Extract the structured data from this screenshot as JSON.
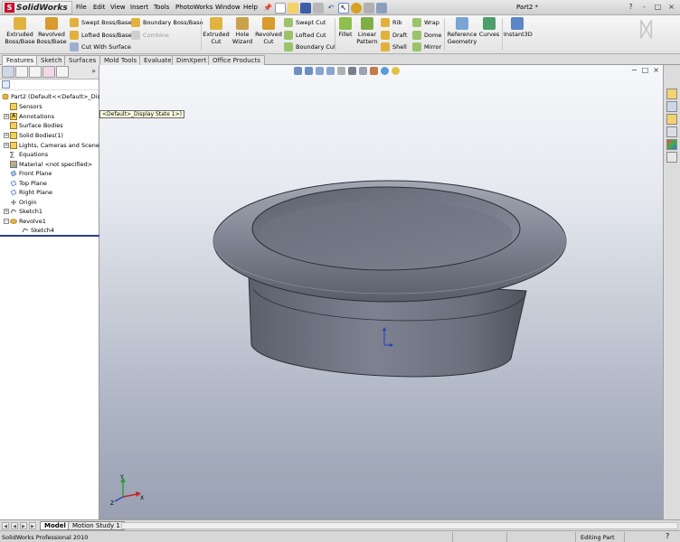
{
  "app": {
    "logo_mark": "S",
    "logo_text": "SolidWorks",
    "document_title": "Part2 *"
  },
  "menu": [
    "File",
    "Edit",
    "View",
    "Insert",
    "Tools",
    "PhotoWorks",
    "Window",
    "Help"
  ],
  "window_controls": [
    "?",
    "-",
    "□",
    "×"
  ],
  "ribbon": {
    "extruded_boss": "Extruded Boss/Base",
    "revolved_boss": "Revolved Boss/Base",
    "swept_boss": "Swept Boss/Base",
    "lofted_boss": "Lofted Boss/Base",
    "boundary_boss": "Boundary Boss/Base",
    "combine": "Combine",
    "cut_with_surface": "Cut With Surface",
    "extruded_cut": "Extruded Cut",
    "hole_wizard": "Hole Wizard",
    "revolved_cut": "Revolved Cut",
    "swept_cut": "Swept Cut",
    "lofted_cut": "Lofted Cut",
    "boundary_cut": "Boundary Cut",
    "fillet": "Fillet",
    "linear_pattern": "Linear Pattern",
    "rib": "Rib",
    "draft": "Draft",
    "shell": "Shell",
    "wrap": "Wrap",
    "dome": "Dome",
    "mirror": "Mirror",
    "reference_geometry": "Reference Geometry",
    "curves": "Curves",
    "instant3d": "Instant3D"
  },
  "tabs": [
    "Features",
    "Sketch",
    "Surfaces",
    "Mold Tools",
    "Evaluate",
    "DimXpert",
    "Office Products"
  ],
  "feature_tree": {
    "part": "Part2  (Default<<Default>_Displa",
    "tooltip": "<Default>_Display State 1>)",
    "items": [
      {
        "label": "Sensors",
        "icon": "sensor-icon"
      },
      {
        "label": "Annotations",
        "icon": "annotation-icon"
      },
      {
        "label": "Surface Bodies",
        "icon": "surface-bodies-icon"
      },
      {
        "label": "Solid Bodies(1)",
        "icon": "solid-bodies-icon"
      },
      {
        "label": "Lights, Cameras and Scene",
        "icon": "lights-icon"
      },
      {
        "label": "Equations",
        "icon": "equations-icon"
      },
      {
        "label": "Material <not specified>",
        "icon": "material-icon"
      },
      {
        "label": "Front Plane",
        "icon": "plane-icon"
      },
      {
        "label": "Top Plane",
        "icon": "plane-icon"
      },
      {
        "label": "Right Plane",
        "icon": "plane-icon"
      },
      {
        "label": "Origin",
        "icon": "origin-icon"
      },
      {
        "label": "Sketch1",
        "icon": "sketch-icon"
      },
      {
        "label": "Revolve1",
        "icon": "revolve-icon"
      },
      {
        "label": "Sketch4",
        "icon": "sketch-icon"
      }
    ]
  },
  "bottom_tabs": [
    "Model",
    "Motion Study 1"
  ],
  "status": {
    "product": "SolidWorks Professional 2010",
    "mode": "Editing Part"
  },
  "colors": {
    "logo_red": "#c8102e",
    "model_gray": "#6e7381",
    "background_top": "#f7f8fb",
    "background_bottom": "#98a0b2",
    "rollback_bar": "#2a3f8f"
  }
}
